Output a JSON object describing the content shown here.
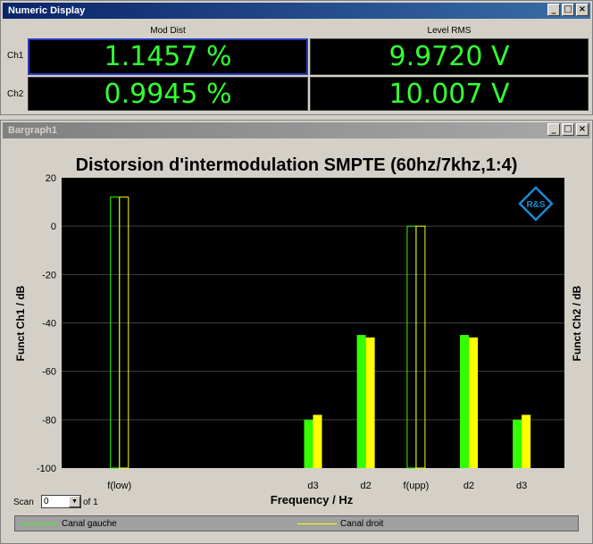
{
  "numeric_window": {
    "title": "Numeric Display",
    "buttons": [
      "_",
      "□",
      "×"
    ],
    "columns": [
      "Mod Dist",
      "Level RMS"
    ],
    "rows": [
      {
        "label": "Ch1",
        "values": [
          "1.1457 %",
          "9.9720 V"
        ]
      },
      {
        "label": "Ch2",
        "values": [
          "0.9945 %",
          "10.007 V"
        ]
      }
    ]
  },
  "bargraph_window": {
    "title": "Bargraph1",
    "buttons": [
      "_",
      "□",
      "×"
    ],
    "scan_label": "Scan",
    "scan_value": "0",
    "scan_of": "of 1",
    "logo": "R&S"
  },
  "legend": {
    "left": "Canal gauche",
    "right": "Canal droit"
  },
  "chart_data": {
    "type": "bar",
    "title": "Distorsion d'intermodulation SMPTE (60hz/7khz,1:4)",
    "xlabel": "Frequency / Hz",
    "ylabel_left": "Funct Ch1 / dB",
    "ylabel_right": "Funct Ch2 / dB",
    "ylim": [
      -100,
      20
    ],
    "yticks": [
      20,
      0,
      -20,
      -40,
      -60,
      -80,
      -100
    ],
    "grid": true,
    "colors": {
      "left": "#33ff00",
      "right": "#ffff00",
      "background": "#000000",
      "grid": "#404040"
    },
    "categories": [
      "f(low)",
      "d3",
      "d2",
      "f(upp)",
      "d2",
      "d3"
    ],
    "category_positions": [
      0.115,
      0.5,
      0.605,
      0.705,
      0.81,
      0.915
    ],
    "series": [
      {
        "name": "Canal gauche",
        "values": [
          12,
          -80,
          -45,
          0,
          -45,
          -80
        ]
      },
      {
        "name": "Canal droit",
        "values": [
          12,
          -78,
          -46,
          0,
          -46,
          -78
        ]
      }
    ],
    "outline_categories": [
      0,
      3
    ]
  }
}
